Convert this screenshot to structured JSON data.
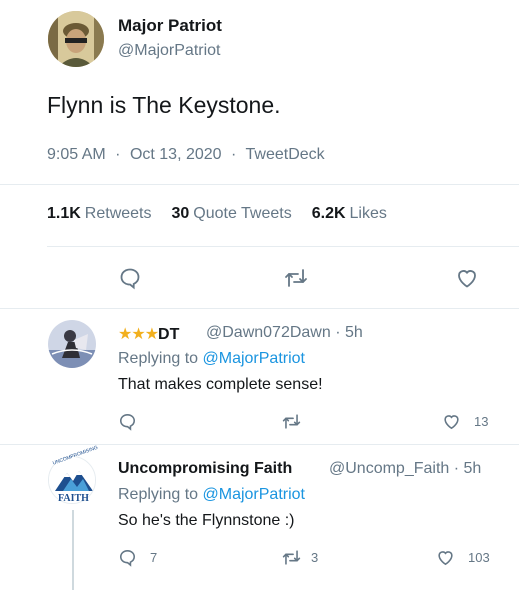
{
  "main_tweet": {
    "author_name": "Major Patriot",
    "author_handle": "@MajorPatriot",
    "text": "Flynn is The Keystone.",
    "time": "9:05 AM",
    "separator": "·",
    "date": "Oct 13, 2020",
    "source": "TweetDeck",
    "stats": {
      "retweets_count": "1.1K",
      "retweets_label": "Retweets",
      "quote_count": "30",
      "quote_label": "Quote Tweets",
      "likes_count": "6.2K",
      "likes_label": "Likes"
    }
  },
  "replies": [
    {
      "stars": "★★★",
      "author_name": "DT",
      "author_handle": "@Dawn072Dawn",
      "separator": "·",
      "time": "5h",
      "replying_prefix": "Replying to",
      "replying_to": "@MajorPatriot",
      "text": "That makes complete sense!",
      "like_count": "13"
    },
    {
      "author_name": "Uncompromising Faith",
      "author_handle": "@Uncomp_Faith",
      "separator": "·",
      "time": "5h",
      "replying_prefix": "Replying to",
      "replying_to": "@MajorPatriot",
      "text": "So he's the Flynnstone :)",
      "reply_count": "7",
      "retweet_count": "3",
      "like_count": "103",
      "avatar_top_text": "UNCOMPROMISING",
      "avatar_bottom_text": "FAITH"
    }
  ],
  "colors": {
    "accent": "#1b95e0",
    "muted": "#657786",
    "divider": "#e6ecf0"
  },
  "icons": [
    "reply-icon",
    "retweet-icon",
    "like-icon"
  ]
}
